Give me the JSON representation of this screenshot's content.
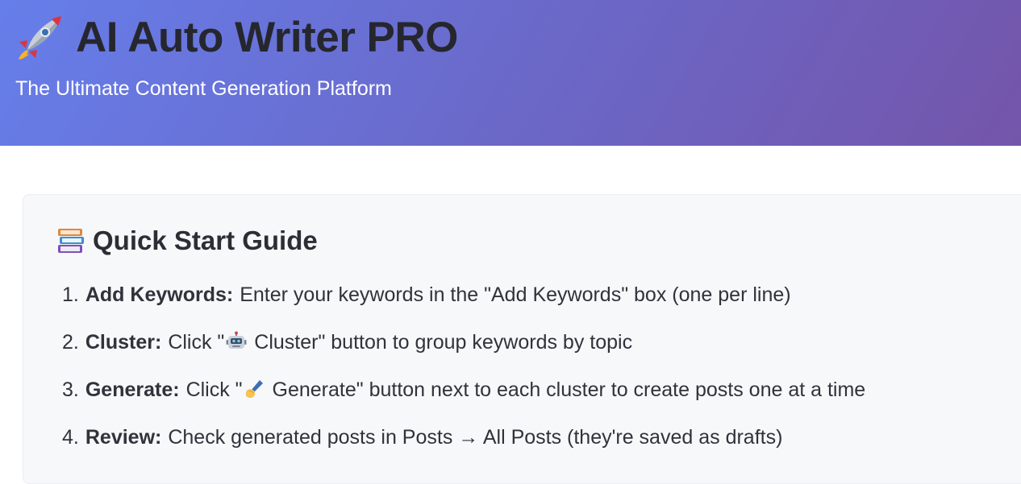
{
  "header": {
    "title": "AI Auto Writer PRO",
    "subtitle": "The Ultimate Content Generation Platform",
    "title_icon": "rocket-icon",
    "gradient_start": "#667eea",
    "gradient_end": "#764ba2"
  },
  "guide": {
    "heading": "Quick Start Guide",
    "heading_icon": "books-icon",
    "steps": [
      {
        "number": "1.",
        "title": "Add Keywords:",
        "text": "Enter your keywords in the \"Add Keywords\" box (one per line)"
      },
      {
        "number": "2.",
        "title": "Cluster:",
        "text_before": "Click \"",
        "icon": "robot-icon",
        "text_after": " Cluster\" button to group keywords by topic"
      },
      {
        "number": "3.",
        "title": "Generate:",
        "text_before": "Click \"",
        "icon": "writing-hand-icon",
        "text_after": " Generate\" button next to each cluster to create posts one at a time"
      },
      {
        "number": "4.",
        "title": "Review:",
        "text": "Check generated posts in Posts → All Posts (they're saved as drafts)"
      }
    ]
  }
}
